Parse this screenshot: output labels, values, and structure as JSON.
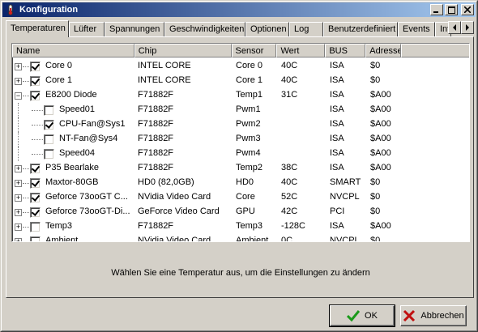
{
  "window": {
    "title": "Konfiguration"
  },
  "tabs": [
    {
      "label": "Temperaturen",
      "active": true
    },
    {
      "label": "Lüfter"
    },
    {
      "label": "Spannungen"
    },
    {
      "label": "Geschwindigkeiten"
    },
    {
      "label": "Optionen"
    },
    {
      "label": "Log"
    },
    {
      "label": "Benutzerdefiniert"
    },
    {
      "label": "Events"
    },
    {
      "label": "Int"
    }
  ],
  "columns": [
    "Name",
    "Chip",
    "Sensor",
    "Wert",
    "BUS",
    "Adresse"
  ],
  "rows": [
    {
      "name": "Core 0",
      "chip": "INTEL CORE",
      "sensor": "Core 0",
      "wert": "40C",
      "bus": "ISA",
      "adresse": "$0",
      "checked": true,
      "level": 0,
      "expander": "+"
    },
    {
      "name": "Core 1",
      "chip": "INTEL CORE",
      "sensor": "Core 1",
      "wert": "40C",
      "bus": "ISA",
      "adresse": "$0",
      "checked": true,
      "level": 0,
      "expander": "+"
    },
    {
      "name": "E8200 Diode",
      "chip": "F71882F",
      "sensor": "Temp1",
      "wert": "31C",
      "bus": "ISA",
      "adresse": "$A00",
      "checked": true,
      "level": 0,
      "expander": "−"
    },
    {
      "name": "Speed01",
      "chip": "F71882F",
      "sensor": "Pwm1",
      "wert": "",
      "bus": "ISA",
      "adresse": "$A00",
      "checked": false,
      "level": 1
    },
    {
      "name": "CPU-Fan@Sys1",
      "chip": "F71882F",
      "sensor": "Pwm2",
      "wert": "",
      "bus": "ISA",
      "adresse": "$A00",
      "checked": true,
      "level": 1
    },
    {
      "name": "NT-Fan@Sys4",
      "chip": "F71882F",
      "sensor": "Pwm3",
      "wert": "",
      "bus": "ISA",
      "adresse": "$A00",
      "checked": false,
      "level": 1
    },
    {
      "name": "Speed04",
      "chip": "F71882F",
      "sensor": "Pwm4",
      "wert": "",
      "bus": "ISA",
      "adresse": "$A00",
      "checked": false,
      "level": 1
    },
    {
      "name": "P35 Bearlake",
      "chip": "F71882F",
      "sensor": "Temp2",
      "wert": "38C",
      "bus": "ISA",
      "adresse": "$A00",
      "checked": true,
      "level": 0,
      "expander": "+"
    },
    {
      "name": "Maxtor-80GB",
      "chip": "HD0 (82,0GB)",
      "sensor": "HD0",
      "wert": "40C",
      "bus": "SMART",
      "adresse": "$0",
      "checked": true,
      "level": 0,
      "expander": "+"
    },
    {
      "name": "Geforce 73ooGT C...",
      "chip": "NVidia Video Card",
      "sensor": "Core",
      "wert": "52C",
      "bus": "NVCPL",
      "adresse": "$0",
      "checked": true,
      "level": 0,
      "expander": "+"
    },
    {
      "name": "Geforce 73ooGT-Di...",
      "chip": "GeForce Video Card",
      "sensor": "GPU",
      "wert": "42C",
      "bus": "PCI",
      "adresse": "$0",
      "checked": true,
      "level": 0,
      "expander": "+"
    },
    {
      "name": "Temp3",
      "chip": "F71882F",
      "sensor": "Temp3",
      "wert": "-128C",
      "bus": "ISA",
      "adresse": "$A00",
      "checked": false,
      "level": 0,
      "expander": "+"
    },
    {
      "name": "Ambient",
      "chip": "NVidia Video Card",
      "sensor": "Ambient",
      "wert": "0C",
      "bus": "NVCPL",
      "adresse": "$0",
      "checked": false,
      "level": 0,
      "expander": "+"
    }
  ],
  "hint": "Wählen Sie eine Temperatur aus, um die Einstellungen zu ändern",
  "buttons": {
    "ok": "OK",
    "cancel": "Abbrechen"
  },
  "colors": {
    "titlebar_start": "#0a246a",
    "titlebar_end": "#a6caf0",
    "ok_check": "#1a9a1a",
    "cancel_x": "#c01010"
  }
}
